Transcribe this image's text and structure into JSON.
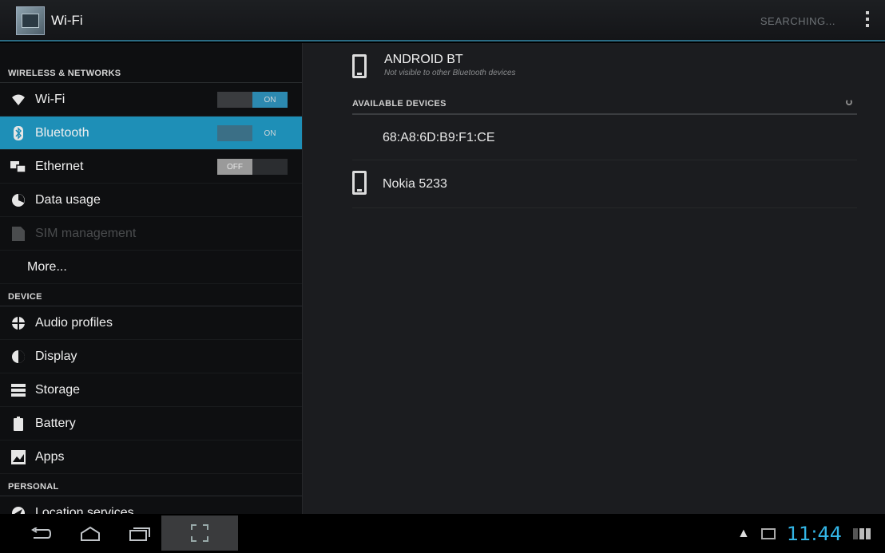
{
  "actionbar": {
    "title": "Wi-Fi",
    "searching_label": "SEARCHING..."
  },
  "sidebar": {
    "categories": {
      "wireless": "WIRELESS & NETWORKS",
      "device": "DEVICE",
      "personal": "PERSONAL"
    },
    "items": [
      {
        "label": "Wi-Fi",
        "icon": "wifi-icon",
        "toggle": "ON"
      },
      {
        "label": "Bluetooth",
        "icon": "bluetooth-icon",
        "toggle": "ON"
      },
      {
        "label": "Ethernet",
        "icon": "ethernet-icon",
        "toggle": "OFF"
      },
      {
        "label": "Data usage",
        "icon": "data-usage-icon"
      },
      {
        "label": "SIM management",
        "icon": "sim-icon"
      },
      {
        "label": "More..."
      },
      {
        "label": "Audio profiles",
        "icon": "audio-profiles-icon"
      },
      {
        "label": "Display",
        "icon": "display-icon"
      },
      {
        "label": "Storage",
        "icon": "storage-icon"
      },
      {
        "label": "Battery",
        "icon": "battery-icon"
      },
      {
        "label": "Apps",
        "icon": "apps-icon"
      },
      {
        "label": "Location services",
        "icon": "location-icon"
      }
    ]
  },
  "bluetooth": {
    "own_device_name": "ANDROID BT",
    "own_device_status": "Not visible to other Bluetooth devices",
    "available_header": "AVAILABLE DEVICES",
    "devices": [
      {
        "name": "68:A8:6D:B9:F1:CE"
      },
      {
        "name": "Nokia 5233",
        "icon": "phone-icon"
      }
    ]
  },
  "statusbar": {
    "time": "11:44"
  },
  "colors": {
    "accent": "#33b5e5",
    "selected_bg": "#1e8fb7"
  }
}
